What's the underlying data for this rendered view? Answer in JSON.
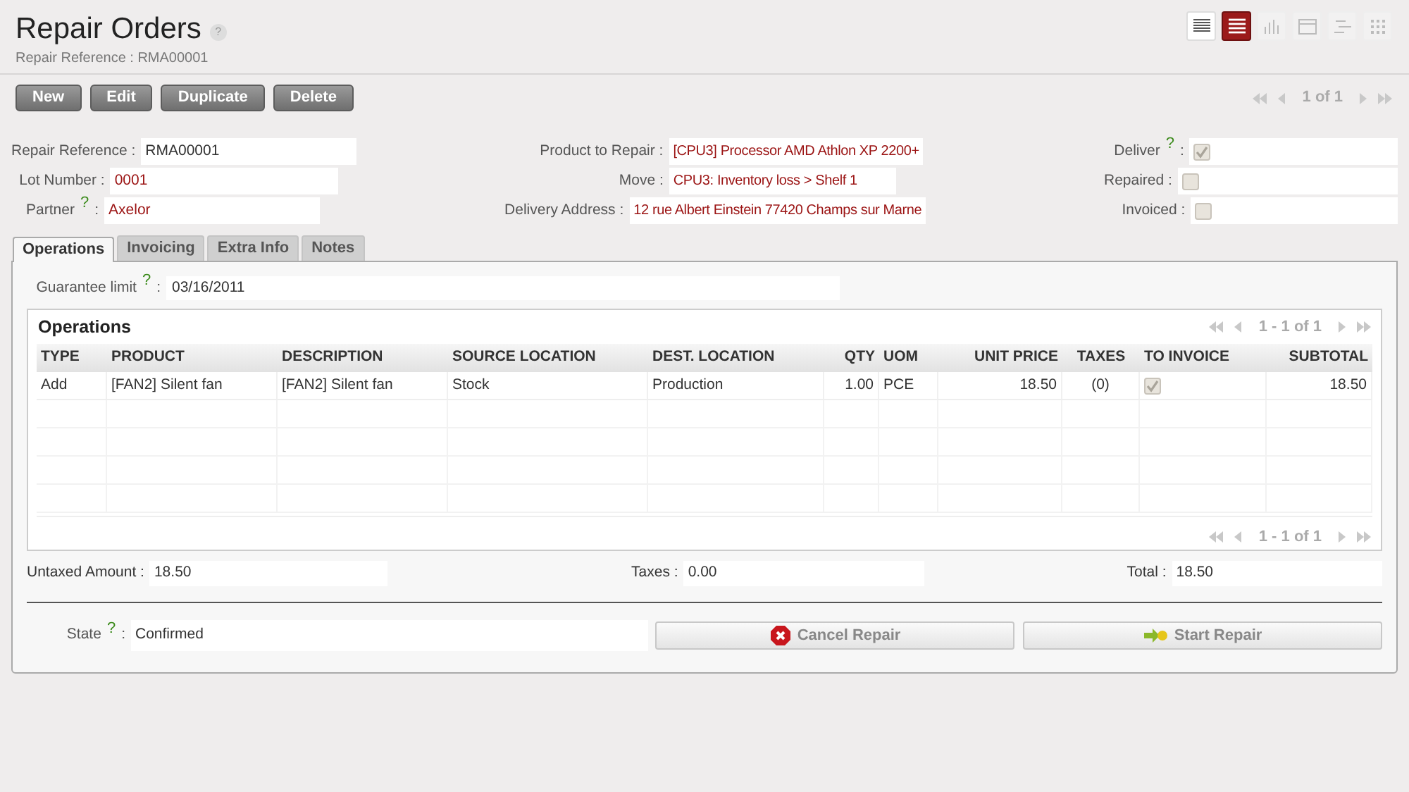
{
  "header": {
    "title": "Repair Orders",
    "help_mark": "?",
    "subtitle": "Repair Reference : RMA00001"
  },
  "view_switcher": [
    {
      "kind": "list",
      "selected": false
    },
    {
      "kind": "form",
      "selected": true
    },
    {
      "kind": "graph",
      "selected": false
    },
    {
      "kind": "calendar",
      "selected": false
    },
    {
      "kind": "gantt",
      "selected": false
    },
    {
      "kind": "kanban",
      "selected": false
    }
  ],
  "buttons": [
    "New",
    "Edit",
    "Duplicate",
    "Delete"
  ],
  "pager": "1 of 1",
  "form_rows": [
    [
      {
        "label": "Repair Reference :",
        "kind": "text",
        "value": "RMA00001"
      },
      {
        "label": "Product to Repair :",
        "kind": "link",
        "value": "[CPU3] Processor AMD Athlon XP 2200+"
      },
      {
        "label": "Deliver",
        "help": "?",
        "colon": ":",
        "kind": "checkbox",
        "checked": true
      }
    ],
    [
      {
        "label": "Lot Number :",
        "kind": "link",
        "value": "0001"
      },
      {
        "label": "Move :",
        "kind": "link",
        "value": "CPU3: Inventory loss > Shelf 1"
      },
      {
        "label": "Repaired :",
        "kind": "checkbox",
        "checked": false
      }
    ],
    [
      {
        "label": "Partner",
        "help": "?",
        "colon": ":",
        "kind": "link",
        "value": "Axelor"
      },
      {
        "label": "Delivery Address :",
        "kind": "link",
        "value": "12 rue Albert Einstein 77420 Champs sur Marne"
      },
      {
        "label": "Invoiced :",
        "kind": "checkbox",
        "checked": false
      }
    ]
  ],
  "tabs": [
    {
      "label": "Operations",
      "selected": true
    },
    {
      "label": "Invoicing",
      "selected": false
    },
    {
      "label": "Extra Info",
      "selected": false
    },
    {
      "label": "Notes",
      "selected": false
    }
  ],
  "guarantee": {
    "label": "Guarantee limit",
    "help": "?",
    "colon": ":",
    "value": "03/16/2011"
  },
  "operations": {
    "title": "Operations",
    "pager_top": "1 - 1 of 1",
    "pager_bottom": "1 - 1 of 1",
    "columns": [
      "TYPE",
      "PRODUCT",
      "DESCRIPTION",
      "SOURCE LOCATION",
      "DEST. LOCATION",
      "QTY",
      "UOM",
      "UNIT PRICE",
      "TAXES",
      "TO INVOICE",
      "SUBTOTAL"
    ],
    "rows": [
      {
        "type": "Add",
        "product": "[FAN2] Silent fan",
        "description": "[FAN2] Silent fan",
        "source": "Stock",
        "dest": "Production",
        "qty": "1.00",
        "uom": "PCE",
        "unit_price": "18.50",
        "taxes": "(0)",
        "to_invoice": true,
        "subtotal": "18.50"
      }
    ]
  },
  "totals": [
    {
      "label": "Untaxed Amount :",
      "value": "18.50"
    },
    {
      "label": "Taxes :",
      "value": "0.00"
    },
    {
      "label": "Total :",
      "value": "18.50"
    }
  ],
  "state": {
    "label": "State",
    "help": "?",
    "colon": ":",
    "value": "Confirmed"
  },
  "actions": [
    {
      "kind": "cancel",
      "label": "Cancel Repair"
    },
    {
      "kind": "start",
      "label": "Start Repair"
    }
  ]
}
